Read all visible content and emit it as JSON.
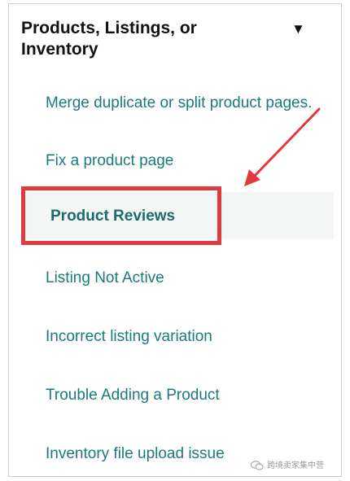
{
  "header": {
    "title": "Products, Listings, or Inventory",
    "toggle_icon": "triangle-down-icon"
  },
  "menu": {
    "items": [
      {
        "label": "Merge duplicate or split product pages."
      },
      {
        "label": "Fix a product page"
      },
      {
        "label": "Product Reviews",
        "active": true
      },
      {
        "label": "Listing Not Active"
      },
      {
        "label": "Incorrect listing variation"
      },
      {
        "label": "Trouble Adding a Product"
      },
      {
        "label": "Inventory file upload issue"
      }
    ]
  },
  "annotation": {
    "highlight_color": "#e03a3e",
    "arrow_color": "#e03a3e"
  },
  "watermark": {
    "text": "跨境卖家集中营",
    "icon": "wechat-icon"
  },
  "colors": {
    "link": "#1a7a7d",
    "active_link": "#1a6c6f",
    "active_bg": "#f4f5f5"
  }
}
